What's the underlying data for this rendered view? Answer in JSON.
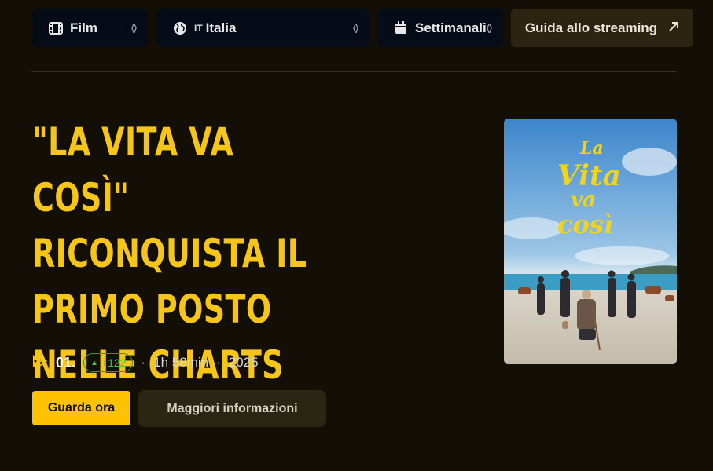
{
  "filters": {
    "type": {
      "label": "Film",
      "icon": "film-icon"
    },
    "country": {
      "flag_text": "IT",
      "label": "Italia",
      "icon": "globe-icon"
    },
    "period": {
      "label": "Settimanali",
      "icon": "calendar-icon"
    }
  },
  "guide_button": {
    "label": "Guida allo streaming",
    "icon": "external-arrow-icon"
  },
  "article": {
    "headline": "\"LA VITA VA COSÌ\" RICONQUISTA IL PRIMO POSTO NELLE CHARTS",
    "rank": "01.",
    "rank_change": "+122",
    "runtime": "1h 58min",
    "year": "2025",
    "poster_title_lines": [
      "La",
      "Vita",
      "va",
      "così"
    ]
  },
  "actions": {
    "watch_label": "Guarda ora",
    "info_label": "Maggiori informazioni"
  },
  "colors": {
    "accent": "#f5c518",
    "watch_button": "#ffc200",
    "positive": "#43c152",
    "background": "#140f06"
  }
}
